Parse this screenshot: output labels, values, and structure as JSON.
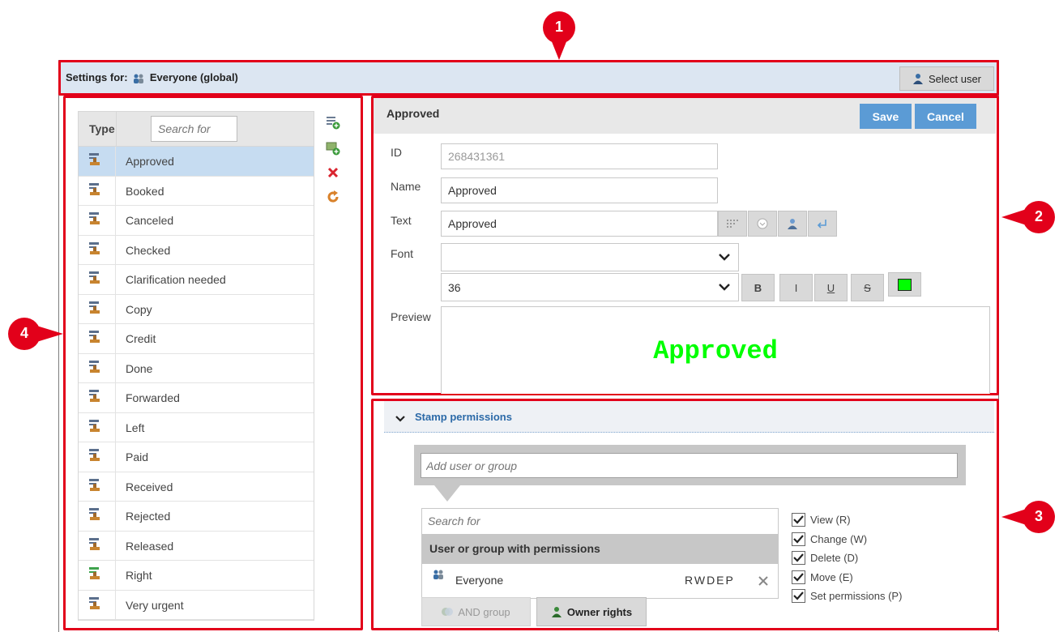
{
  "header": {
    "settings_prefix": "Settings for:",
    "settings_target": "Everyone (global)",
    "select_user_label": "Select user"
  },
  "callouts": [
    "1",
    "2",
    "3",
    "4"
  ],
  "stamp_list": {
    "type_header": "Type",
    "search_placeholder": "Search for",
    "items": [
      {
        "label": "Approved",
        "icon": "stamp-icon",
        "selected": true
      },
      {
        "label": "Booked",
        "icon": "stamp-icon"
      },
      {
        "label": "Canceled",
        "icon": "stamp-icon"
      },
      {
        "label": "Checked",
        "icon": "stamp-icon"
      },
      {
        "label": "Clarification needed",
        "icon": "stamp-icon"
      },
      {
        "label": "Copy",
        "icon": "stamp-icon"
      },
      {
        "label": "Credit",
        "icon": "stamp-icon"
      },
      {
        "label": "Done",
        "icon": "stamp-icon"
      },
      {
        "label": "Forwarded",
        "icon": "stamp-icon"
      },
      {
        "label": "Left",
        "icon": "stamp-icon"
      },
      {
        "label": "Paid",
        "icon": "stamp-icon"
      },
      {
        "label": "Received",
        "icon": "stamp-icon"
      },
      {
        "label": "Rejected",
        "icon": "stamp-icon"
      },
      {
        "label": "Released",
        "icon": "stamp-icon"
      },
      {
        "label": "Right",
        "icon": "image-stamp-icon"
      },
      {
        "label": "Very urgent",
        "icon": "stamp-icon"
      }
    ],
    "actions": [
      "add-text-stamp-icon",
      "add-image-stamp-icon",
      "delete-icon",
      "refresh-icon"
    ]
  },
  "form": {
    "title": "Approved",
    "save_label": "Save",
    "cancel_label": "Cancel",
    "id_label": "ID",
    "id_value": "268431361",
    "name_label": "Name",
    "name_value": "Approved",
    "text_label": "Text",
    "text_value": "Approved",
    "font_label": "Font",
    "font_value": "",
    "size_value": "36",
    "bold_label": "B",
    "italic_label": "I",
    "underline_label": "U",
    "strike_label": "S",
    "color": "#00ff00",
    "preview_label": "Preview",
    "preview_text": "Approved"
  },
  "permissions": {
    "section_title": "Stamp permissions",
    "add_placeholder": "Add user or group",
    "search_placeholder": "Search for",
    "list_header": "User or group with permissions",
    "entries": [
      {
        "name": "Everyone",
        "rights": "RWDEP"
      }
    ],
    "and_group_label": "AND group",
    "owner_rights_label": "Owner rights",
    "checkboxes": [
      {
        "label": "View (R)",
        "checked": true
      },
      {
        "label": "Change (W)",
        "checked": true
      },
      {
        "label": "Delete (D)",
        "checked": true
      },
      {
        "label": "Move (E)",
        "checked": true
      },
      {
        "label": "Set permissions (P)",
        "checked": true
      }
    ]
  },
  "colors": {
    "accent": "#5b9bd5",
    "callout": "#e2001a",
    "selection": "#c6dcf1",
    "preview_text": "#00ff00"
  }
}
